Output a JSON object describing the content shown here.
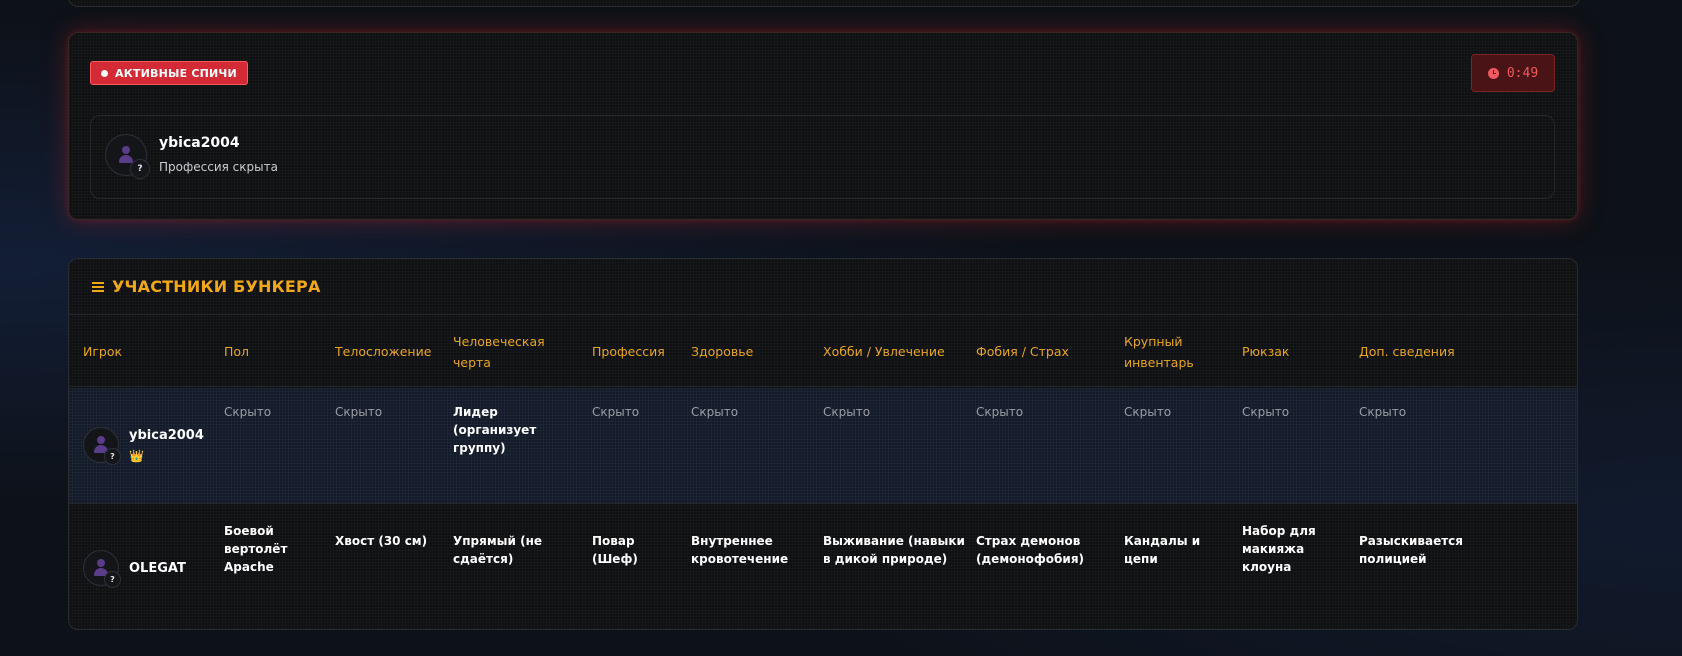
{
  "speech": {
    "badge": "АКТИВНЫЕ СПИЧИ",
    "timer": "0:49",
    "speaker": {
      "name": "ybica2004",
      "subtitle": "Профессия скрыта"
    }
  },
  "participants": {
    "title": "УЧАСТНИКИ БУНКЕРА",
    "columns": [
      "Игрок",
      "Пол",
      "Телосложение",
      "Человеческая черта",
      "Профессия",
      "Здоровье",
      "Хобби / Увлечение",
      "Фобия / Страх",
      "Крупный инвентарь",
      "Рюкзак",
      "Доп. сведения"
    ],
    "rows": [
      {
        "player": "ybica2004",
        "crown": "👑",
        "cells": [
          "Скрыто",
          "Скрыто",
          "Лидер (организует группу)",
          "Скрыто",
          "Скрыто",
          "Скрыто",
          "Скрыто",
          "Скрыто",
          "Скрыто",
          "Скрыто"
        ]
      },
      {
        "player": "OLEGAT",
        "cells": [
          "Боевой вертолёт Apache",
          "Хвост (30 см)",
          "Упрямый (не сдаётся)",
          "Повар (Шеф)",
          "Внутреннее кровотечение",
          "Выживание (навыки в дикой природе)",
          "Страх демонов (демонофобия)",
          "Кандалы и цепи",
          "Набор для макияжа клоуна",
          "Разыскивается полицией"
        ]
      }
    ]
  },
  "colors": {
    "accent": "#f0a818",
    "live_badge": "#d42a35",
    "timer_text": "#f0595f",
    "highlight_row": "#131b2a"
  }
}
